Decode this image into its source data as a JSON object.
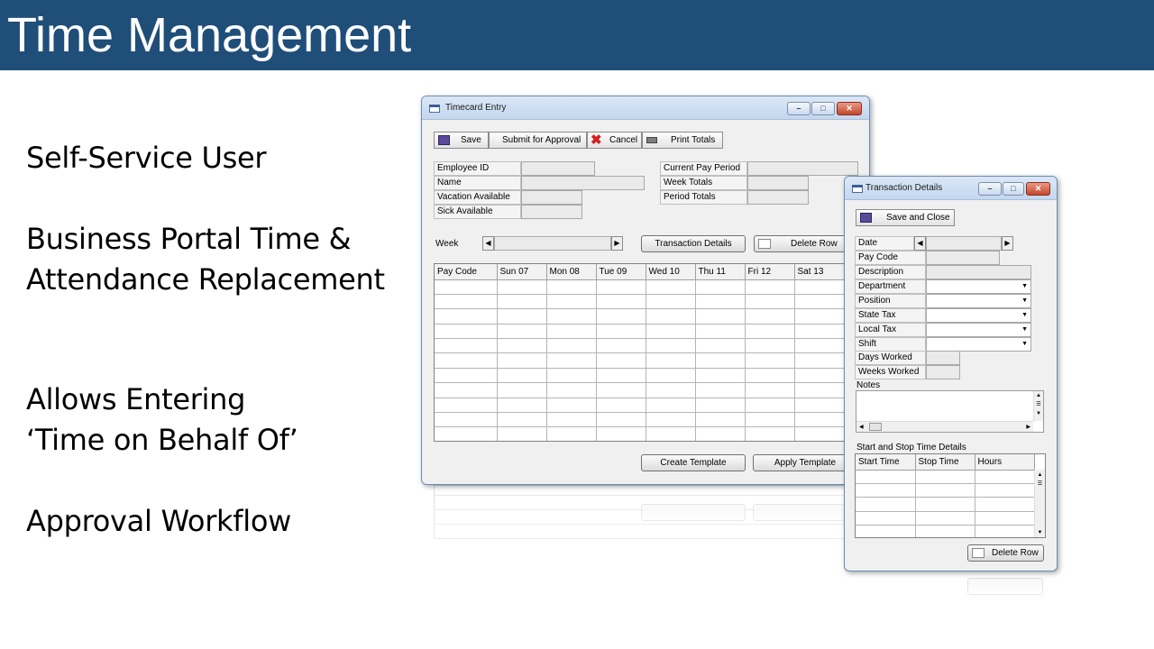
{
  "slide": {
    "title": "Time Management",
    "bullets": [
      "Self-Service User",
      "Business Portal Time & Attendance Replacement",
      "Allows Entering ‘Time on Behalf Of’",
      "Approval Workflow"
    ]
  },
  "timecard_window": {
    "title": "Timecard Entry",
    "toolbar": {
      "save": "Save",
      "submit": "Submit for Approval",
      "cancel": "Cancel",
      "print_totals": "Print Totals"
    },
    "fields": {
      "employee_id": "Employee ID",
      "name": "Name",
      "vacation_available": "Vacation Available",
      "sick_available": "Sick Available",
      "current_pay_period": "Current Pay Period",
      "week_totals": "Week Totals",
      "period_totals": "Period Totals"
    },
    "week_label": "Week",
    "transaction_details_button": "Transaction Details",
    "delete_row_button": "Delete Row",
    "grid_columns": [
      "Pay Code",
      "Sun 07",
      "Mon 08",
      "Tue 09",
      "Wed 10",
      "Thu 11",
      "Fri 12",
      "Sat 13"
    ],
    "create_template_button": "Create Template",
    "apply_template_button": "Apply Template"
  },
  "transaction_window": {
    "title": "Transaction Details",
    "save_close_button": "Save and Close",
    "fields": {
      "date": "Date",
      "pay_code": "Pay Code",
      "description": "Description",
      "department": "Department",
      "position": "Position",
      "state_tax": "State Tax",
      "local_tax": "Local Tax",
      "shift": "Shift",
      "days_worked": "Days Worked",
      "weeks_worked": "Weeks Worked",
      "notes": "Notes"
    },
    "start_stop_label": "Start and Stop Time Details",
    "grid_columns": [
      "Start Time",
      "Stop Time",
      "Hours"
    ],
    "delete_row_button": "Delete Row"
  },
  "colors": {
    "title_banner": "#1f4e79",
    "window_border": "#6b8cb5"
  }
}
